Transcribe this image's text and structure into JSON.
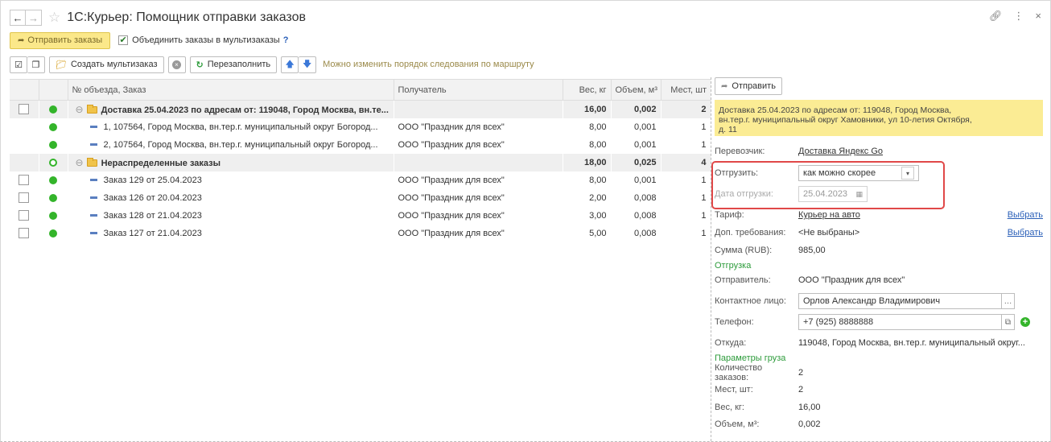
{
  "window": {
    "title": "1С:Курьер: Помощник отправки заказов"
  },
  "toolbar": {
    "send_orders": "Отправить заказы",
    "combine_label": "Объединить заказы в мультизаказы",
    "combine_checked": true,
    "help": "?",
    "create_multi": "Создать мультизаказ",
    "refill": "Перезаполнить",
    "route_hint": "Можно изменить порядок следования по маршруту"
  },
  "table": {
    "headers": [
      "№ объезда, Заказ",
      "Получатель",
      "Вес, кг",
      "Объем, м³",
      "Мест, шт"
    ],
    "rows": [
      {
        "kind": "group",
        "checkbox": true,
        "dot": "full",
        "name": "Доставка 25.04.2023 по адресам от: 119048, Город Москва, вн.те...",
        "recipient": "",
        "weight": "16,00",
        "volume": "0,002",
        "places": "2"
      },
      {
        "kind": "item",
        "checkbox": false,
        "dot": "full",
        "name": "1, 107564, Город Москва, вн.тер.г. муниципальный округ Богород...",
        "recipient": "ООО \"Праздник для всех\"",
        "weight": "8,00",
        "volume": "0,001",
        "places": "1"
      },
      {
        "kind": "item",
        "checkbox": false,
        "dot": "full",
        "name": "2, 107564, Город Москва, вн.тер.г. муниципальный округ Богород...",
        "recipient": "ООО \"Праздник для всех\"",
        "weight": "8,00",
        "volume": "0,001",
        "places": "1"
      },
      {
        "kind": "group",
        "checkbox": false,
        "dot": "empty",
        "name": "Нераспределенные заказы",
        "recipient": "",
        "weight": "18,00",
        "volume": "0,025",
        "places": "4"
      },
      {
        "kind": "item",
        "checkbox": true,
        "dot": "full",
        "name": "Заказ 129 от 25.04.2023",
        "recipient": "ООО \"Праздник для всех\"",
        "weight": "8,00",
        "volume": "0,001",
        "places": "1"
      },
      {
        "kind": "item",
        "checkbox": true,
        "dot": "full",
        "name": "Заказ 126 от 20.04.2023",
        "recipient": "ООО \"Праздник для всех\"",
        "weight": "2,00",
        "volume": "0,008",
        "places": "1"
      },
      {
        "kind": "item",
        "checkbox": true,
        "dot": "full",
        "name": "Заказ 128 от 21.04.2023",
        "recipient": "ООО \"Праздник для всех\"",
        "weight": "3,00",
        "volume": "0,008",
        "places": "1"
      },
      {
        "kind": "item",
        "checkbox": true,
        "dot": "full",
        "name": "Заказ 127 от 21.04.2023",
        "recipient": "ООО \"Праздник для всех\"",
        "weight": "5,00",
        "volume": "0,008",
        "places": "1"
      }
    ]
  },
  "panel": {
    "send": "Отправить",
    "notice_line1": "Доставка 25.04.2023 по адресам от: 119048, Город Москва,",
    "notice_line2": "вн.тер.г. муниципальный округ Хамовники, ул 10-летия Октября,",
    "notice_line3": "д. 11",
    "carrier_label": "Перевозчик:",
    "carrier_value": "Доставка Яндекс Go",
    "ship_label": "Отгрузить:",
    "ship_value": "как можно скорее",
    "ship_date_label": "Дата отгрузки:",
    "ship_date_value": "25.04.2023",
    "tariff_label": "Тариф:",
    "tariff_value": "Курьер на авто",
    "choose": "Выбрать",
    "extra_label": "Доп. требования:",
    "extra_value": "<Не выбраны>",
    "sum_label": "Сумма (RUB):",
    "sum_value": "985,00",
    "section_shipment": "Отгрузка",
    "sender_label": "Отправитель:",
    "sender_value": "ООО \"Праздник для всех\"",
    "contact_label": "Контактное лицо:",
    "contact_value": "Орлов Александр Владимирович",
    "phone_label": "Телефон:",
    "phone_value": "+7 (925) 8888888",
    "from_label": "Откуда:",
    "from_value": "119048, Город Москва, вн.тер.г. муниципальный округ...",
    "section_cargo": "Параметры груза",
    "orders_count_label": "Количество заказов:",
    "orders_count_value": "2",
    "places_label": "Мест, шт:",
    "places_value": "2",
    "weight_label": "Вес, кг:",
    "weight_value": "16,00",
    "volume_label": "Объем, м³:",
    "volume_value": "0,002"
  }
}
